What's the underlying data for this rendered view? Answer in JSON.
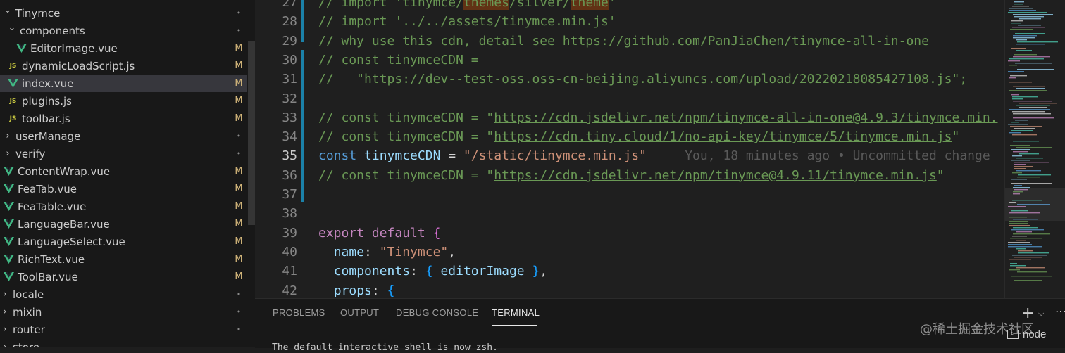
{
  "explorer": {
    "rows": [
      {
        "label": "Tinymce",
        "type": "folder",
        "open": true,
        "indent": 0,
        "dec": "•"
      },
      {
        "label": "components",
        "type": "folder",
        "open": true,
        "indent": 1,
        "dec": "•"
      },
      {
        "label": "EditorImage.vue",
        "type": "vue",
        "indent": 2,
        "dec": "M"
      },
      {
        "label": "dynamicLoadScript.js",
        "type": "js",
        "indent": 1,
        "dec": "M"
      },
      {
        "label": "index.vue",
        "type": "vue",
        "indent": 1,
        "dec": "M",
        "selected": true
      },
      {
        "label": "plugins.js",
        "type": "js",
        "indent": 1,
        "dec": "M"
      },
      {
        "label": "toolbar.js",
        "type": "js",
        "indent": 1,
        "dec": "M"
      },
      {
        "label": "userManage",
        "type": "folder",
        "open": false,
        "indent": 0,
        "dec": "•"
      },
      {
        "label": "verify",
        "type": "folder",
        "open": false,
        "indent": 0,
        "dec": "•"
      },
      {
        "label": "ContentWrap.vue",
        "type": "vue",
        "indent": 0,
        "dec": "M"
      },
      {
        "label": "FeaTab.vue",
        "type": "vue",
        "indent": 0,
        "dec": "M"
      },
      {
        "label": "FeaTable.vue",
        "type": "vue",
        "indent": 0,
        "dec": "M"
      },
      {
        "label": "LanguageBar.vue",
        "type": "vue",
        "indent": 0,
        "dec": "M"
      },
      {
        "label": "LanguageSelect.vue",
        "type": "vue",
        "indent": 0,
        "dec": "M"
      },
      {
        "label": "RichText.vue",
        "type": "vue",
        "indent": 0,
        "dec": "M"
      },
      {
        "label": "ToolBar.vue",
        "type": "vue",
        "indent": 0,
        "dec": "M"
      },
      {
        "label": "locale",
        "type": "folder",
        "open": false,
        "indent": -1,
        "dec": "•"
      },
      {
        "label": "mixin",
        "type": "folder",
        "open": false,
        "indent": -1,
        "dec": "•"
      },
      {
        "label": "router",
        "type": "folder",
        "open": false,
        "indent": -1,
        "dec": "•"
      },
      {
        "label": "store",
        "type": "folder",
        "open": false,
        "indent": -1,
        "dec": ""
      }
    ]
  },
  "editor": {
    "lines": [
      {
        "n": "27",
        "tokens": [
          [
            "cmt",
            "// import 'tinymce/"
          ],
          [
            "hlc",
            "themes"
          ],
          [
            "cmt",
            "/silver/"
          ],
          [
            "hlc",
            "theme"
          ],
          [
            "cmt",
            "'"
          ]
        ]
      },
      {
        "n": "28",
        "tokens": [
          [
            "cmt",
            "// import '../../assets/tinymce.min.js'"
          ]
        ]
      },
      {
        "n": "29",
        "tokens": [
          [
            "cmt",
            "// why use this cdn, detail see "
          ],
          [
            "lnk",
            "https://github.com/PanJiaChen/tinymce-all-in-one"
          ]
        ]
      },
      {
        "n": "30",
        "tokens": [
          [
            "cmt",
            "// const tinymceCDN ="
          ]
        ]
      },
      {
        "n": "31",
        "tokens": [
          [
            "cmt",
            "//   \""
          ],
          [
            "lnk",
            "https://dev--test-oss.oss-cn-beijing.aliyuncs.com/upload/20220218085427108.js"
          ],
          [
            "cmt",
            "\";"
          ]
        ]
      },
      {
        "n": "32",
        "tokens": []
      },
      {
        "n": "33",
        "tokens": [
          [
            "cmt",
            "// const tinymceCDN = \""
          ],
          [
            "lnk",
            "https://cdn.jsdelivr.net/npm/tinymce-all-in-one@4.9.3/tinymce.min."
          ]
        ]
      },
      {
        "n": "34",
        "tokens": [
          [
            "cmt",
            "// const tinymceCDN = \""
          ],
          [
            "lnk",
            "https://cdn.tiny.cloud/1/no-api-key/tinymce/5/tinymce.min.js"
          ],
          [
            "cmt",
            "\""
          ]
        ]
      },
      {
        "n": "35",
        "tokens": [
          [
            "kw",
            "const "
          ],
          [
            "var",
            "tinymceCDN"
          ],
          [
            "txt",
            " = "
          ],
          [
            "str",
            "\"/static/tinymce.min.js\""
          ],
          [
            "ghost",
            "     You, 18 minutes ago • Uncommitted change"
          ]
        ],
        "active": true
      },
      {
        "n": "36",
        "tokens": [
          [
            "cmt",
            "// const tinymceCDN = \""
          ],
          [
            "lnk",
            "https://cdn.jsdelivr.net/npm/tinymce@4.9.11/tinymce.min.js"
          ],
          [
            "cmt",
            "\""
          ]
        ]
      },
      {
        "n": "37",
        "tokens": []
      },
      {
        "n": "38",
        "tokens": []
      },
      {
        "n": "39",
        "tokens": [
          [
            "kwp",
            "export default "
          ],
          [
            "brace",
            "{"
          ]
        ]
      },
      {
        "n": "40",
        "tokens": [
          [
            "txt",
            "  "
          ],
          [
            "var",
            "name"
          ],
          [
            "txt",
            ": "
          ],
          [
            "str",
            "\"Tinymce\""
          ],
          [
            "txt",
            ","
          ]
        ]
      },
      {
        "n": "41",
        "tokens": [
          [
            "txt",
            "  "
          ],
          [
            "var",
            "components"
          ],
          [
            "txt",
            ": "
          ],
          [
            "brace2",
            "{ "
          ],
          [
            "var",
            "editorImage "
          ],
          [
            "brace2",
            "}"
          ],
          [
            "txt",
            ","
          ]
        ]
      },
      {
        "n": "42",
        "tokens": [
          [
            "txt",
            "  "
          ],
          [
            "var",
            "props"
          ],
          [
            "txt",
            ": "
          ],
          [
            "brace2",
            "{"
          ]
        ]
      }
    ]
  },
  "panel": {
    "tabs": [
      "PROBLEMS",
      "OUTPUT",
      "DEBUG CONSOLE",
      "TERMINAL"
    ],
    "active_tab": "TERMINAL",
    "terminal_text": "The default interactive shell is now zsh.",
    "terminal_name": "node",
    "watermark": "@稀土掘金技术社区"
  },
  "colors": {
    "accent": "#1b81a8",
    "modified": "#d7ba7d"
  }
}
